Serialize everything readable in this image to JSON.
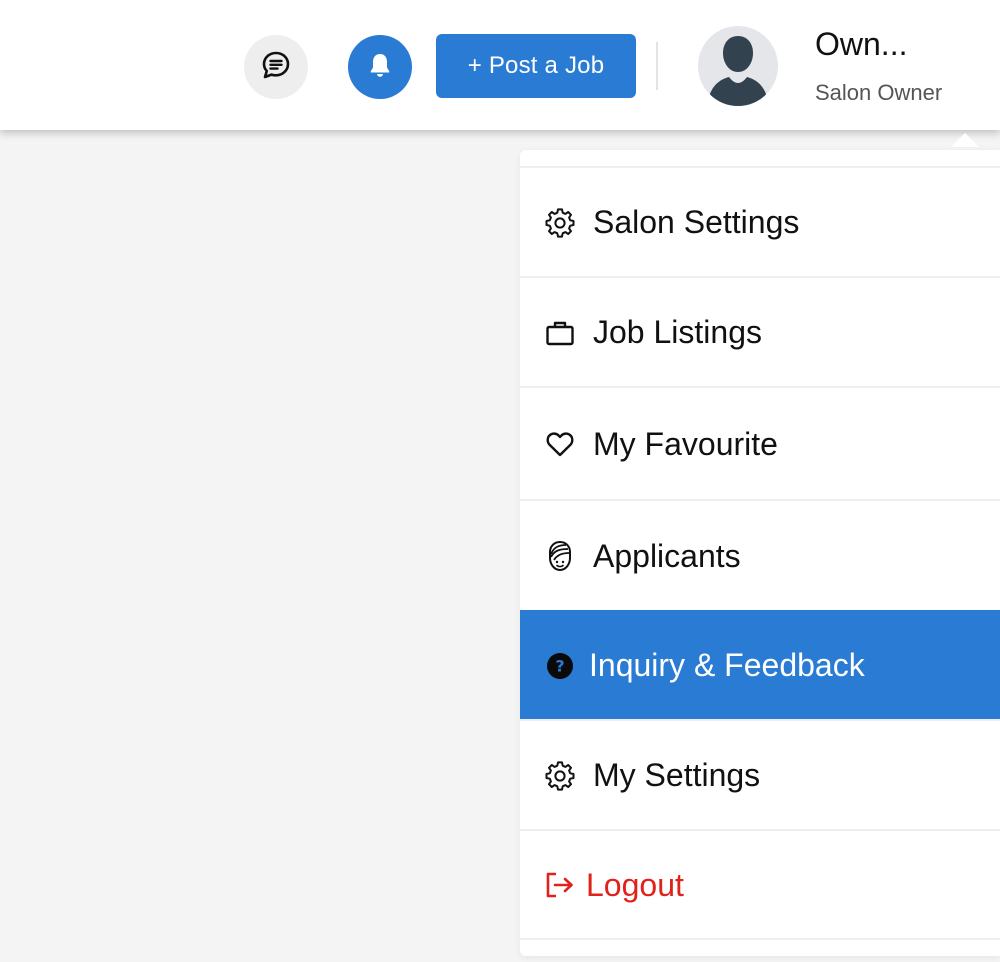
{
  "header": {
    "chat_icon": "chat-bubble-icon",
    "notification_icon": "bell-icon",
    "post_job_label": "+ Post a Job",
    "user": {
      "name": "Own...",
      "role": "Salon Owner",
      "avatar_icon": "user-silhouette-icon"
    }
  },
  "menu": {
    "items": [
      {
        "label": "Salon Settings",
        "icon": "gear-icon"
      },
      {
        "label": "Job Listings",
        "icon": "briefcase-icon"
      },
      {
        "label": "My Favourite",
        "icon": "heart-icon"
      },
      {
        "label": "Applicants",
        "icon": "person-headwrap-icon"
      },
      {
        "label": "Inquiry & Feedback",
        "icon": "question-circle-icon",
        "active": true
      },
      {
        "label": "My Settings",
        "icon": "gear-icon"
      },
      {
        "label": "Logout",
        "icon": "logout-icon"
      }
    ]
  },
  "colors": {
    "accent": "#2a7bd3",
    "logout": "#e0221b",
    "background": "#f4f4f4"
  }
}
